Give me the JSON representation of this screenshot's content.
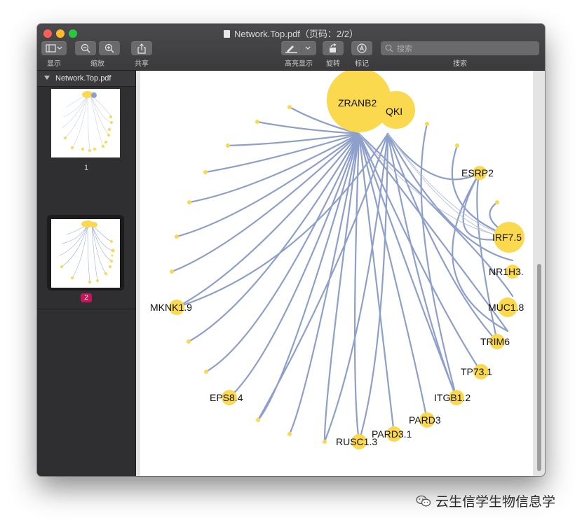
{
  "window": {
    "title": "Network.Top.pdf（页码：2/2）"
  },
  "toolbar": {
    "view_label": "显示",
    "zoom_label": "缩放",
    "share_label": "共享",
    "highlight_label": "高亮显示",
    "rotate_label": "旋转",
    "markup_label": "标记",
    "search_label": "搜索",
    "search_placeholder": "搜索"
  },
  "sidebar": {
    "header": "Network.Top.pdf",
    "pages": [
      {
        "label": "1",
        "selected": false
      },
      {
        "label": "2",
        "selected": true
      }
    ]
  },
  "network": {
    "hubs": [
      "ZRANB2",
      "QKI"
    ],
    "labeled_nodes": [
      "ESRP2",
      "IRF7.5",
      "NR1H3.",
      "MUC1.8",
      "TRIM6",
      "TP73.1",
      "ITGB1.2",
      "PARD3",
      "PARD3.1",
      "RUSC1.3",
      "EPS8.4",
      "MKNK1.9"
    ],
    "node_color": "#fbd94f",
    "edge_color": "#8e9fcc"
  },
  "watermark": {
    "text": "云生信学生物信息学"
  }
}
